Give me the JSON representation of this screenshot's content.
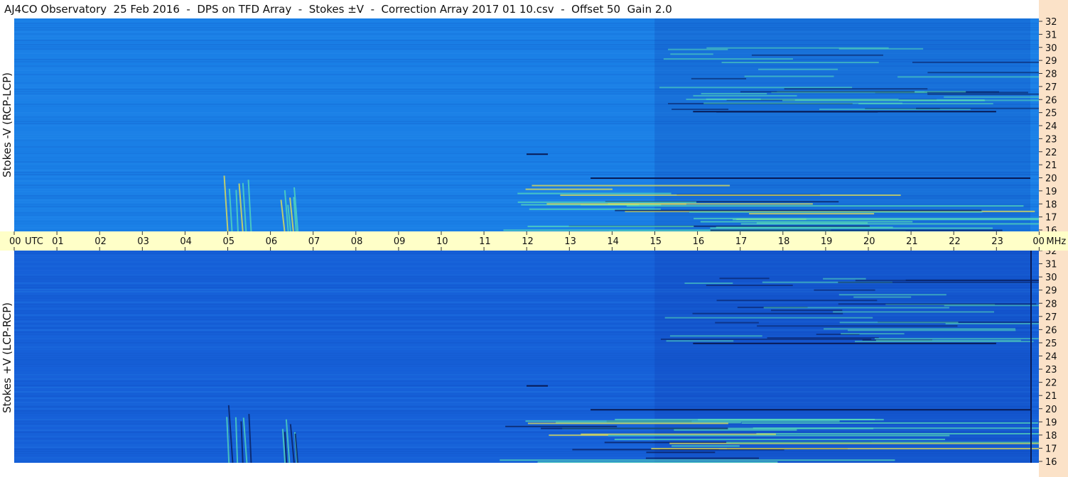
{
  "title": "AJ4CO Observatory  25 Feb 2016  -  DPS on TFD Array  -  Stokes ±V  -  Correction Array 2017 01 10.csv  -  Offset 50  Gain 2.0",
  "panels": {
    "top_ylabel": "Stokes -V (RCP-LCP)",
    "bottom_ylabel": "Stokes +V (LCP-RCP)"
  },
  "colors": {
    "background": "#ffffff",
    "freq_axis_bg": "#fbe2c8",
    "time_axis_bg": "#ffffc8",
    "spectrogram_base_top": "#1a7fe6",
    "spectrogram_base_bottom": "#1660d8",
    "burst_hot": "#f3e84a",
    "burst_warm": "#58e0b8",
    "dark_trace": "#081a55"
  },
  "chart_data": [
    {
      "type": "heatmap",
      "title": "AJ4CO Observatory  25 Feb 2016  -  DPS on TFD Array  -  Stokes ±V  -  Correction Array 2017 01 10.csv  -  Offset 50  Gain 2.0",
      "ylabel": "Stokes -V (RCP-LCP)",
      "xlabel": "UTC",
      "xlim": [
        0,
        24
      ],
      "ylim": [
        16,
        32
      ],
      "y_unit": "MHz",
      "x_tick_labels": [
        "00",
        "01",
        "02",
        "03",
        "04",
        "05",
        "06",
        "07",
        "08",
        "09",
        "10",
        "11",
        "12",
        "13",
        "14",
        "15",
        "16",
        "17",
        "18",
        "19",
        "20",
        "21",
        "22",
        "23",
        "00"
      ],
      "y_tick_labels": [
        "16",
        "17",
        "18",
        "19",
        "20",
        "21",
        "22",
        "23",
        "24",
        "25",
        "26",
        "27",
        "28",
        "29",
        "30",
        "31",
        "32"
      ],
      "features": [
        {
          "label": "strong interference",
          "x": [
            11.3,
            23.8
          ],
          "y": [
            16,
            19.5
          ]
        },
        {
          "label": "storm emission",
          "x": [
            15,
            23.8
          ],
          "y": [
            25,
            30
          ]
        },
        {
          "label": "carrier",
          "x": [
            15.9,
            23
          ],
          "y": [
            25,
            25
          ]
        },
        {
          "label": "carrier",
          "x": [
            13.5,
            23.8
          ],
          "y": [
            20,
            20
          ]
        },
        {
          "label": "carrier",
          "x": [
            12,
            12.5
          ],
          "y": [
            21.8,
            21.8
          ]
        },
        {
          "label": "burst",
          "x": [
            5.0,
            5.6
          ],
          "y": [
            16,
            20.5
          ]
        },
        {
          "label": "burst",
          "x": [
            6.3,
            6.7
          ],
          "y": [
            16,
            19.5
          ]
        }
      ]
    },
    {
      "type": "heatmap",
      "ylabel": "Stokes +V (LCP-RCP)",
      "xlabel": "UTC",
      "xlim": [
        0,
        24
      ],
      "ylim": [
        16,
        32
      ],
      "y_unit": "MHz",
      "x_tick_labels": [
        "00",
        "01",
        "02",
        "03",
        "04",
        "05",
        "06",
        "07",
        "08",
        "09",
        "10",
        "11",
        "12",
        "13",
        "14",
        "15",
        "16",
        "17",
        "18",
        "19",
        "20",
        "21",
        "22",
        "23",
        "00"
      ],
      "y_tick_labels": [
        "16",
        "17",
        "18",
        "19",
        "20",
        "21",
        "22",
        "23",
        "24",
        "25",
        "26",
        "27",
        "28",
        "29",
        "30",
        "31",
        "32"
      ],
      "features": [
        {
          "label": "strong interference",
          "x": [
            11.3,
            23.8
          ],
          "y": [
            16,
            19.5
          ]
        },
        {
          "label": "storm emission",
          "x": [
            15,
            23.8
          ],
          "y": [
            25,
            30
          ]
        },
        {
          "label": "carrier",
          "x": [
            15.9,
            23
          ],
          "y": [
            25,
            25
          ]
        },
        {
          "label": "carrier",
          "x": [
            13.5,
            23.8
          ],
          "y": [
            20,
            20
          ]
        },
        {
          "label": "carrier",
          "x": [
            12,
            12.5
          ],
          "y": [
            21.8,
            21.8
          ]
        },
        {
          "label": "burst",
          "x": [
            5.0,
            5.6
          ],
          "y": [
            16,
            20.5
          ]
        },
        {
          "label": "burst",
          "x": [
            6.3,
            6.7
          ],
          "y": [
            16,
            19.5
          ]
        }
      ]
    }
  ],
  "time_axis": {
    "ticks": [
      "00",
      "01",
      "02",
      "03",
      "04",
      "05",
      "06",
      "07",
      "08",
      "09",
      "10",
      "11",
      "12",
      "13",
      "14",
      "15",
      "16",
      "17",
      "18",
      "19",
      "20",
      "21",
      "22",
      "23",
      "00"
    ],
    "start_suffix": "UTC",
    "end_suffix": "MHz"
  },
  "freq_axis": {
    "ticks": [
      "16",
      "17",
      "18",
      "19",
      "20",
      "21",
      "22",
      "23",
      "24",
      "25",
      "26",
      "27",
      "28",
      "29",
      "30",
      "31",
      "32"
    ]
  }
}
